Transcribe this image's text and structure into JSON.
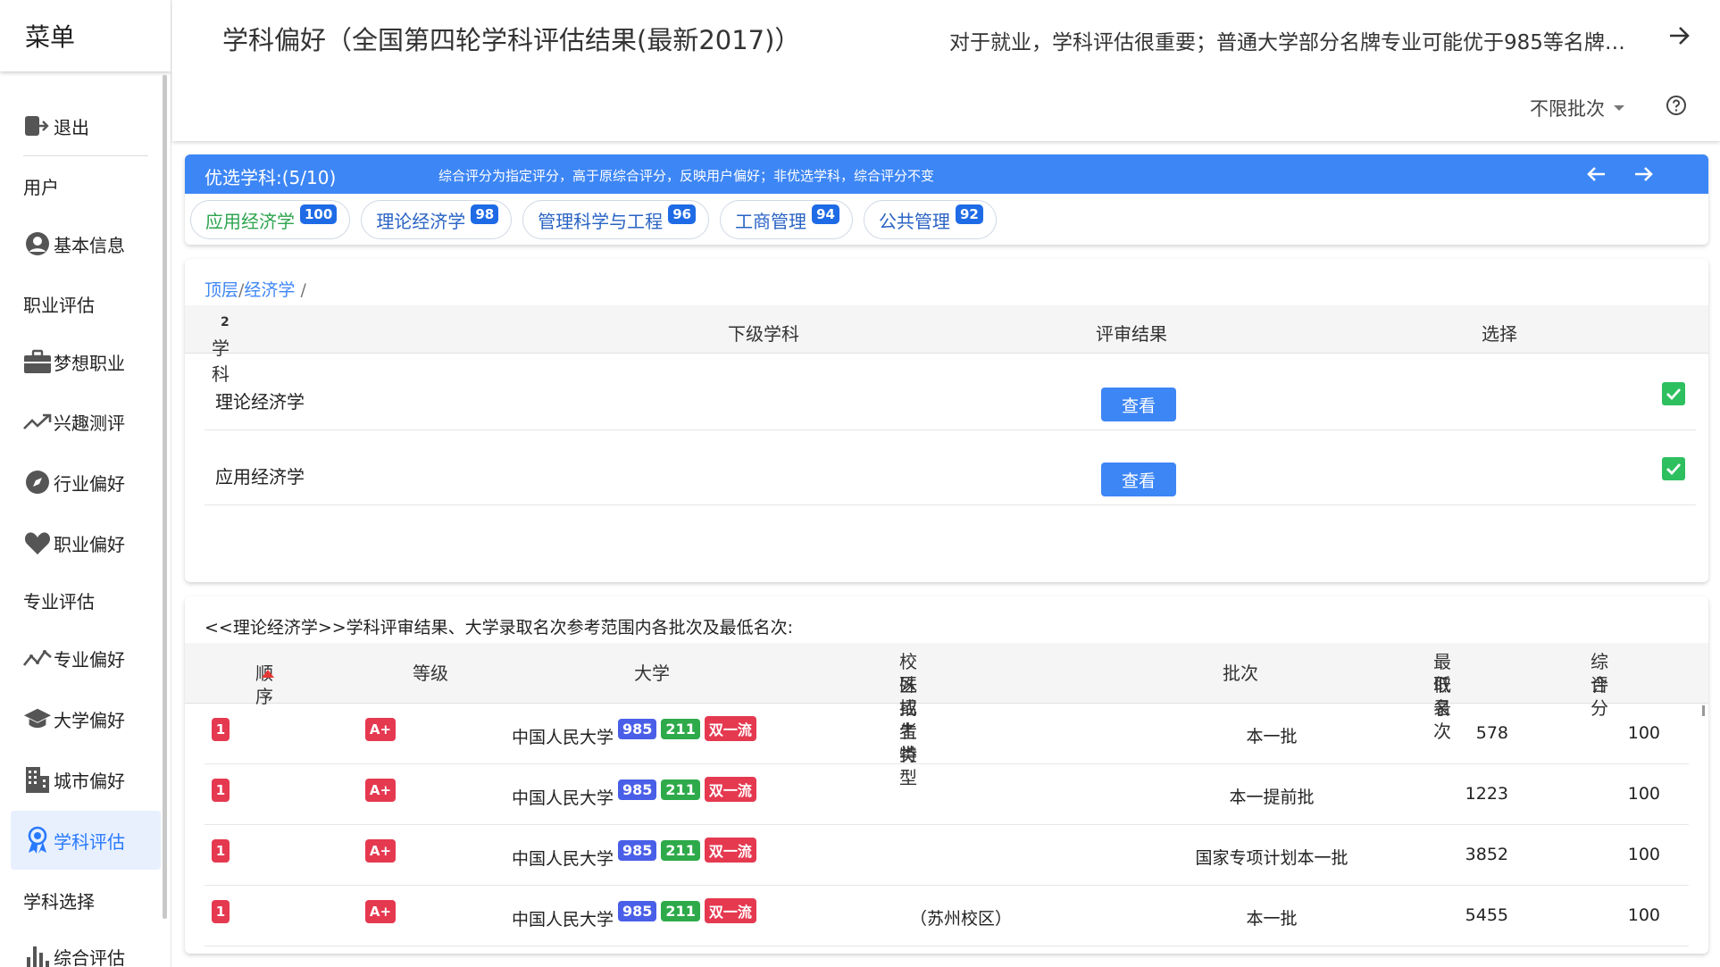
{
  "sidebar": {
    "title": "菜单",
    "items": [
      {
        "label": "退出",
        "icon": "logout-icon"
      },
      {
        "section": "用户"
      },
      {
        "label": "基本信息",
        "icon": "user-icon"
      },
      {
        "section": "职业评估"
      },
      {
        "label": "梦想职业",
        "icon": "briefcase-icon"
      },
      {
        "label": "兴趣测评",
        "icon": "trending-icon"
      },
      {
        "label": "行业偏好",
        "icon": "compass-icon"
      },
      {
        "label": "职业偏好",
        "icon": "heart-icon"
      },
      {
        "section": "专业评估"
      },
      {
        "label": "专业偏好",
        "icon": "chart-line-icon"
      },
      {
        "label": "大学偏好",
        "icon": "school-icon"
      },
      {
        "label": "城市偏好",
        "icon": "building-icon"
      },
      {
        "label": "学科评估",
        "icon": "award-icon",
        "active": true
      },
      {
        "section": "学科选择"
      },
      {
        "label": "综合评估",
        "icon": "bar-chart-icon"
      }
    ]
  },
  "header": {
    "title": "学科偏好（全国第四轮学科评估结果(最新2017)）",
    "notice": "对于就业，学科评估很重要；普通大学部分名牌专业可能优于985等名牌大学",
    "batch_select": "不限批次"
  },
  "preferred": {
    "title": "优选学科:(5/10)",
    "note": "综合评分为指定评分，高于原综合评分，反映用户偏好；非优选学科，综合评分不变",
    "chips": [
      {
        "label": "应用经济学",
        "score": "100"
      },
      {
        "label": "理论经济学",
        "score": "98"
      },
      {
        "label": "管理科学与工程",
        "score": "96"
      },
      {
        "label": "工商管理",
        "score": "94"
      },
      {
        "label": "公共管理",
        "score": "92"
      }
    ]
  },
  "subjects": {
    "breadcrumb": {
      "root": "顶层",
      "level1": "经济学",
      "sep": "/"
    },
    "columns": {
      "subject": "学科",
      "count": "2",
      "sub": "下级学科",
      "result": "评审结果",
      "choose": "选择"
    },
    "rows": [
      {
        "name": "理论经济学",
        "button": "查看",
        "checked": true
      },
      {
        "name": "应用经济学",
        "button": "查看",
        "checked": true
      }
    ]
  },
  "results": {
    "title": "<<理论经济学>>学科评审结果、大学录取名次参考范围内各批次及最低名次:",
    "columns": {
      "order": "顺序",
      "grade": "等级",
      "university": "大学",
      "campus_l1": "校区或者特",
      "campus_l2": "殊招生类型",
      "batch": "批次",
      "min_rank_l1": "最低录",
      "min_rank_l2": "取名次",
      "score_l1": "综合",
      "score_l2": "评分"
    },
    "rows": [
      {
        "order": "1",
        "grade": "A+",
        "university": "中国人民大学",
        "tags": [
          "985",
          "211",
          "双一流"
        ],
        "campus": "",
        "batch": "本一批",
        "min_rank": "578",
        "score": "100"
      },
      {
        "order": "1",
        "grade": "A+",
        "university": "中国人民大学",
        "tags": [
          "985",
          "211",
          "双一流"
        ],
        "campus": "",
        "batch": "本一提前批",
        "min_rank": "1223",
        "score": "100"
      },
      {
        "order": "1",
        "grade": "A+",
        "university": "中国人民大学",
        "tags": [
          "985",
          "211",
          "双一流"
        ],
        "campus": "",
        "batch": "国家专项计划本一批",
        "min_rank": "3852",
        "score": "100"
      },
      {
        "order": "1",
        "grade": "A+",
        "university": "中国人民大学",
        "tags": [
          "985",
          "211",
          "双一流"
        ],
        "campus": "（苏州校区）",
        "batch": "本一批",
        "min_rank": "5455",
        "score": "100"
      }
    ]
  },
  "colors": {
    "primary": "#3d86f5",
    "accent_red": "#e53950",
    "check_green": "#2ebf5f",
    "tag_985": "#4a5fe8",
    "tag_211": "#2eaa4a"
  }
}
